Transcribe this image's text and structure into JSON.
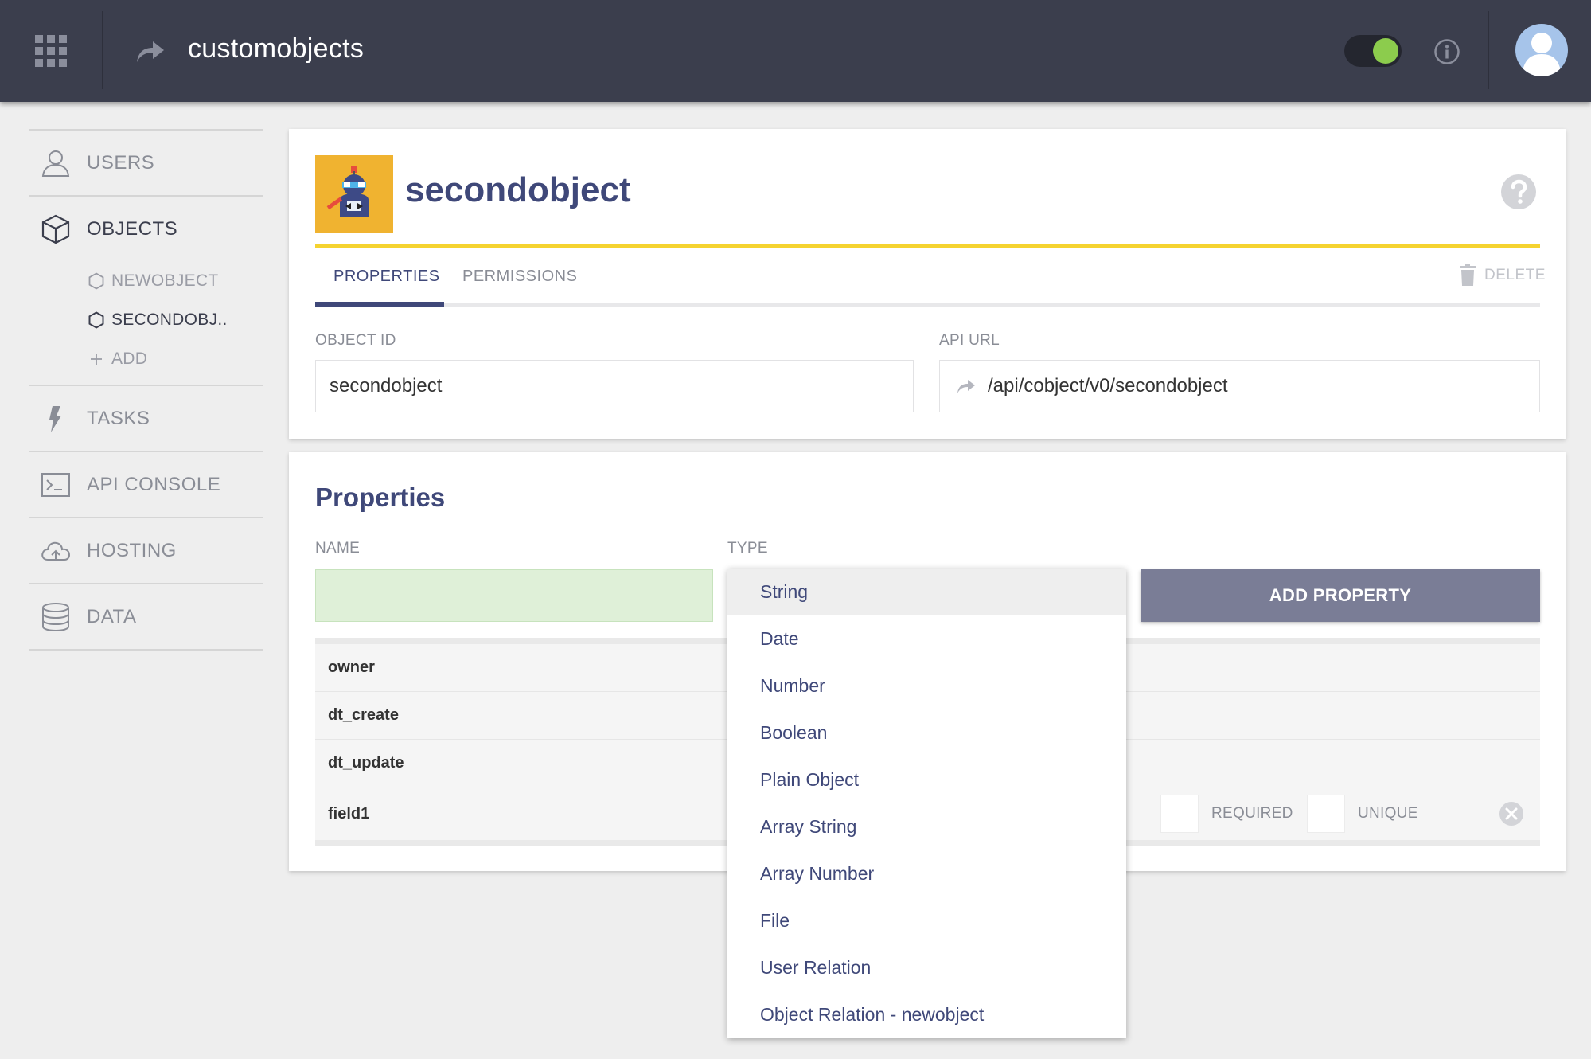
{
  "header": {
    "app_title": "customobjects",
    "toggle_state": "on",
    "icons": [
      "apps-grid-icon",
      "share-arrow-icon",
      "info-icon",
      "user-avatar"
    ]
  },
  "sidebar": {
    "items": [
      {
        "label": "USERS",
        "icon": "user-icon"
      },
      {
        "label": "OBJECTS",
        "icon": "cube-icon"
      },
      {
        "label": "TASKS",
        "icon": "lightning-icon"
      },
      {
        "label": "API CONSOLE",
        "icon": "terminal-icon"
      },
      {
        "label": "HOSTING",
        "icon": "cloud-upload-icon"
      },
      {
        "label": "DATA",
        "icon": "database-icon"
      }
    ],
    "object_subitems": [
      {
        "label": "NEWOBJECT",
        "icon": "hexagon-icon"
      },
      {
        "label": "SECONDOBJ..",
        "icon": "hexagon-icon"
      },
      {
        "label": "ADD",
        "icon": "plus-icon"
      }
    ]
  },
  "object": {
    "title": "secondobject",
    "tabs": [
      "PROPERTIES",
      "PERMISSIONS"
    ],
    "delete_label": "DELETE",
    "object_id_label": "OBJECT ID",
    "object_id_value": "secondobject",
    "api_url_label": "API URL",
    "api_url_value": "/api/cobject/v0/secondobject"
  },
  "properties": {
    "title": "Properties",
    "name_label": "NAME",
    "type_label": "TYPE",
    "add_button": "ADD PROPERTY",
    "rows": [
      {
        "name": "owner"
      },
      {
        "name": "dt_create"
      },
      {
        "name": "dt_update"
      },
      {
        "name": "field1",
        "required_label": "REQUIRED",
        "unique_label": "UNIQUE"
      }
    ]
  },
  "type_dropdown": {
    "selected": "String",
    "options": [
      "String",
      "Date",
      "Number",
      "Boolean",
      "Plain Object",
      "Array String",
      "Array Number",
      "File",
      "User Relation",
      "Object Relation - newobject"
    ]
  },
  "colors": {
    "topbar": "#3b3e4d",
    "accent": "#3f4879",
    "yellow": "#f5d330",
    "toggle_on": "#8ccc4d",
    "name_input_bg": "#dff0d8",
    "add_button": "#7a7d96"
  }
}
